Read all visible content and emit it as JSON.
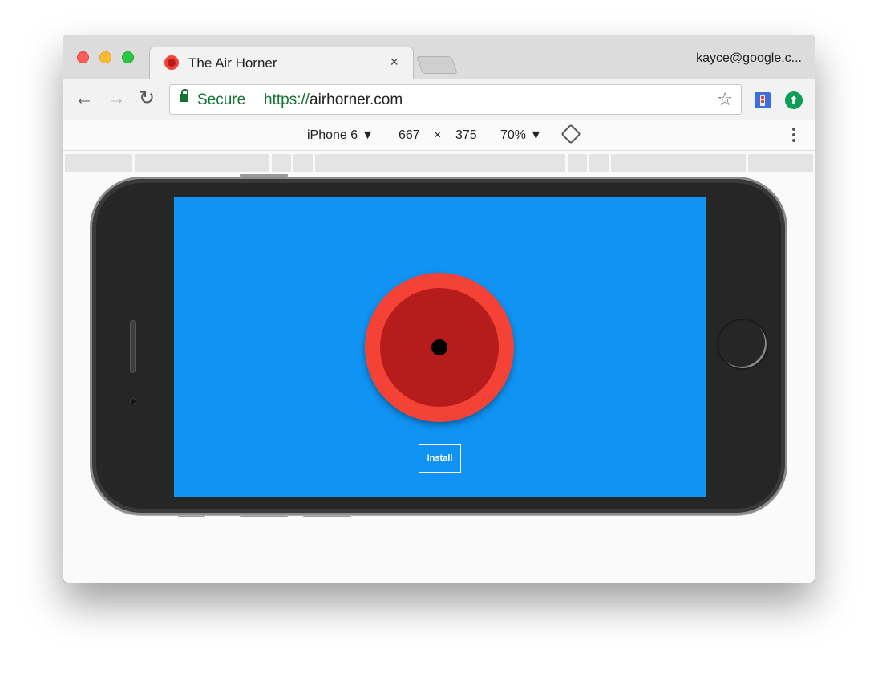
{
  "tab": {
    "title": "The Air Horner",
    "close": "×",
    "favicon": "air-horner-favicon"
  },
  "profile": {
    "name": "kayce@google.c..."
  },
  "toolbar": {
    "back_icon": "←",
    "forward_icon": "→",
    "reload_icon": "↻",
    "secure_label": "Secure",
    "url_scheme": "https://",
    "url_host": "airhorner.com",
    "star_icon": "☆",
    "extension_2_icon": "⬆"
  },
  "device_toolbar": {
    "device": "iPhone 6 ▼",
    "width": "667",
    "times": "×",
    "height": "375",
    "zoom": "70% ▼"
  },
  "page": {
    "background_color": "#1193f3",
    "horn_outer_color": "#f44336",
    "horn_inner_color": "#b71c1c",
    "install_label": "Install"
  }
}
